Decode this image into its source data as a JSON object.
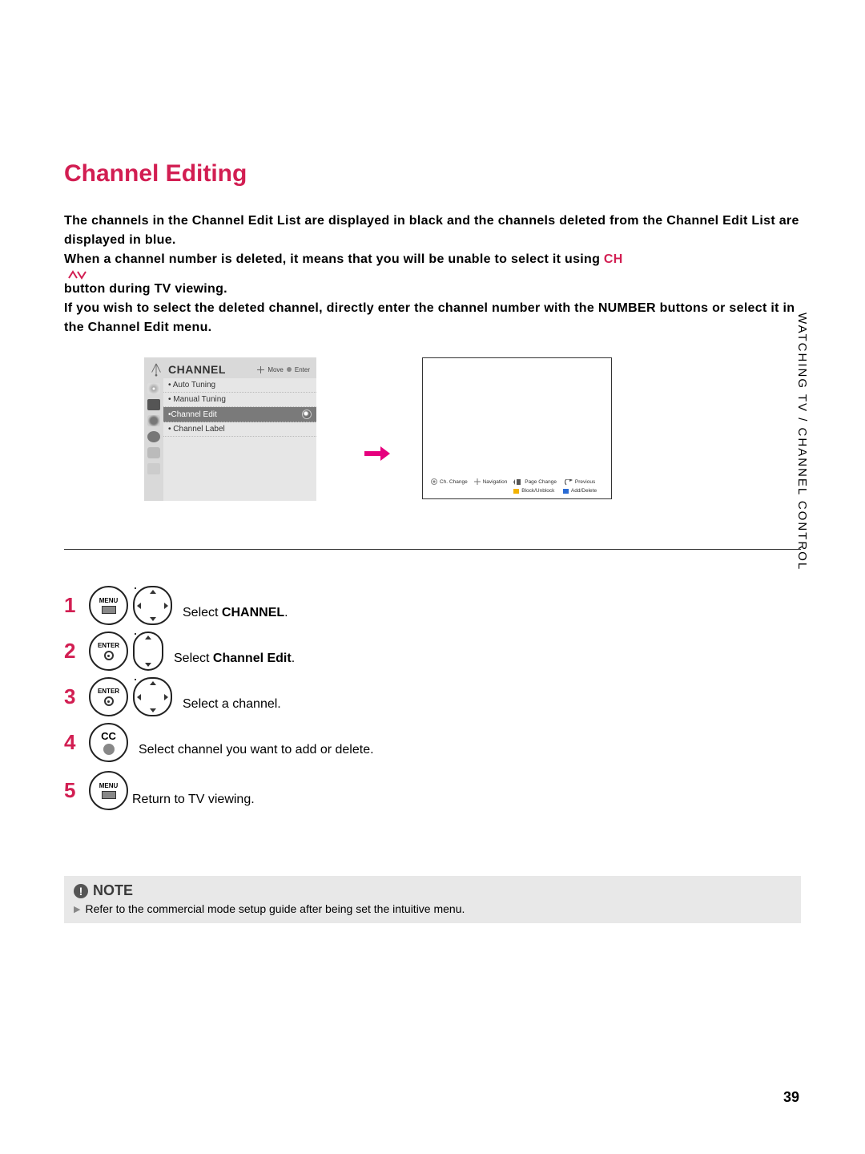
{
  "title": "Channel Editing",
  "intro": {
    "p1": "The channels in the Channel Edit List are displayed in black and the channels deleted from the Channel Edit List are displayed in blue.",
    "p2a": "When a channel number is deleted, it means that you will be unable to select it using ",
    "p2_btn": "CH",
    "p2b": " button during TV viewing.",
    "p3": "If you wish to select the deleted channel, directly enter the channel number with the NUMBER buttons or select it in the Channel Edit menu."
  },
  "channel_panel": {
    "header": "CHANNEL",
    "hdr_move": "Move",
    "hdr_enter": "Enter",
    "items": [
      "Auto Tuning",
      "Manual Tuning",
      "Channel Edit",
      "Channel Label"
    ],
    "selected_index": 2
  },
  "list_legend": {
    "ch_change": "Ch. Change",
    "navigation": "Navigation",
    "page_change": "Page Change",
    "previous": "Previous",
    "block": "Block/Unblock",
    "add_delete": "Add/Delete"
  },
  "side_tab": "WATCHING TV / CHANNEL CONTROL",
  "steps": [
    {
      "num": "1",
      "btn": "menu",
      "pad": "full",
      "txt_pre": "Select ",
      "bold": "CHANNEL",
      "txt_post": "."
    },
    {
      "num": "2",
      "btn": "enter",
      "pad": "ud",
      "txt_pre": "Select ",
      "bold": "Channel Edit",
      "txt_post": "."
    },
    {
      "num": "3",
      "btn": "enter",
      "pad": "full",
      "txt_pre": "Select a channel.",
      "bold": "",
      "txt_post": ""
    },
    {
      "num": "4",
      "btn": "cc",
      "pad": "",
      "txt_pre": "Select channel you want to add or delete.",
      "bold": "",
      "txt_post": ""
    },
    {
      "num": "5",
      "btn": "menu",
      "pad": "",
      "txt_pre": "Return to TV viewing.",
      "bold": "",
      "txt_post": ""
    }
  ],
  "btn_labels": {
    "menu": "MENU",
    "enter": "ENTER",
    "cc": "CC"
  },
  "note": {
    "heading": "NOTE",
    "body": "Refer to the commercial mode setup guide after being set the intuitive menu."
  },
  "page_number": "39"
}
